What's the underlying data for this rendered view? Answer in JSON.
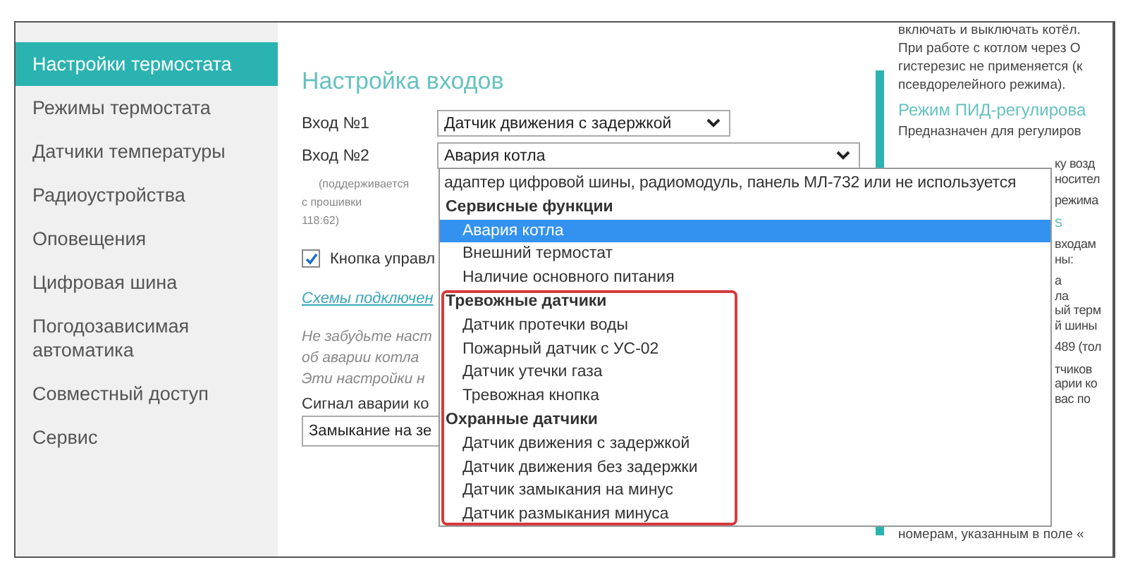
{
  "sidebar": {
    "items": [
      {
        "label": "Настройки термостата",
        "selected": true
      },
      {
        "label": "Режимы термостата",
        "selected": false
      },
      {
        "label": "Датчики температуры",
        "selected": false
      },
      {
        "label": "Радиоустройства",
        "selected": false
      },
      {
        "label": "Оповещения",
        "selected": false
      },
      {
        "label": "Цифровая шина",
        "selected": false
      },
      {
        "label": "Погодозависимая автоматика",
        "selected": false
      },
      {
        "label": "Совместный доступ",
        "selected": false
      },
      {
        "label": "Сервис",
        "selected": false
      }
    ]
  },
  "main": {
    "title": "Настройка входов",
    "inputs": [
      {
        "label": "Вход №1",
        "value": "Датчик движения с задержкой",
        "wide": false
      },
      {
        "label": "Вход №2",
        "value": "Авария котла",
        "wide": true
      }
    ],
    "firmware_note": [
      "(поддерживается",
      "с прошивки",
      "118:62)"
    ],
    "checkbox": {
      "label": "Кнопка управл",
      "checked": true
    },
    "link": "Схемы подключен",
    "notes": [
      "Не забудьте наст",
      "об аварии котла",
      "Эти настройки н"
    ],
    "signal": {
      "label": "Сигнал аварии ко",
      "value": "Замыкание на зе"
    }
  },
  "dropdown": {
    "options": [
      {
        "kind": "text",
        "label": "адаптер цифровой шины, радиомодуль, панель МЛ-732 или не используется"
      },
      {
        "kind": "group",
        "label": "Сервисные функции"
      },
      {
        "kind": "option",
        "label": "Авария котла",
        "selected": true
      },
      {
        "kind": "option",
        "label": "Внешний термостат",
        "selected": false
      },
      {
        "kind": "option",
        "label": "Наличие основного питания",
        "selected": false
      },
      {
        "kind": "group",
        "label": "Тревожные датчики"
      },
      {
        "kind": "option",
        "label": "Датчик протечки воды",
        "selected": false
      },
      {
        "kind": "option",
        "label": "Пожарный датчик с УС-02",
        "selected": false
      },
      {
        "kind": "option",
        "label": "Датчик утечки газа",
        "selected": false
      },
      {
        "kind": "option",
        "label": "Тревожная кнопка",
        "selected": false
      },
      {
        "kind": "group",
        "label": "Охранные датчики"
      },
      {
        "kind": "option",
        "label": "Датчик движения с задержкой",
        "selected": false
      },
      {
        "kind": "option",
        "label": "Датчик движения без задержки",
        "selected": false
      },
      {
        "kind": "option",
        "label": "Датчик замыкания на минус",
        "selected": false
      },
      {
        "kind": "option",
        "label": "Датчик размыкания минуса",
        "selected": false
      }
    ]
  },
  "help": {
    "lines": [
      {
        "kind": "text",
        "text": "включать и выключать котёл."
      },
      {
        "kind": "text",
        "text": "При работе с котлом через О"
      },
      {
        "kind": "text",
        "text": "гистерезис не применяется (к"
      },
      {
        "kind": "text",
        "text": "псевдорелейного режима)."
      },
      {
        "kind": "heading",
        "text": "Режим ПИД-регулирова"
      },
      {
        "kind": "text",
        "text": "Предназначен для регулиров"
      }
    ],
    "fragments": [
      {
        "kind": "text",
        "lines": [
          "ку возд",
          "носител"
        ]
      },
      {
        "kind": "text",
        "lines": [
          "режима"
        ]
      },
      {
        "kind": "heading",
        "lines": [
          "s"
        ]
      },
      {
        "kind": "text",
        "lines": [
          "входам",
          "ны:"
        ]
      },
      {
        "kind": "text",
        "lines": [
          "а",
          "ла",
          "ый терм",
          "й шины"
        ]
      },
      {
        "kind": "text",
        "lines": [
          "489 (тол"
        ]
      },
      {
        "kind": "text",
        "lines": [
          "тчиков",
          "арии ко",
          "вас по"
        ]
      }
    ],
    "bottom": "номерам, указанным в поле «"
  }
}
